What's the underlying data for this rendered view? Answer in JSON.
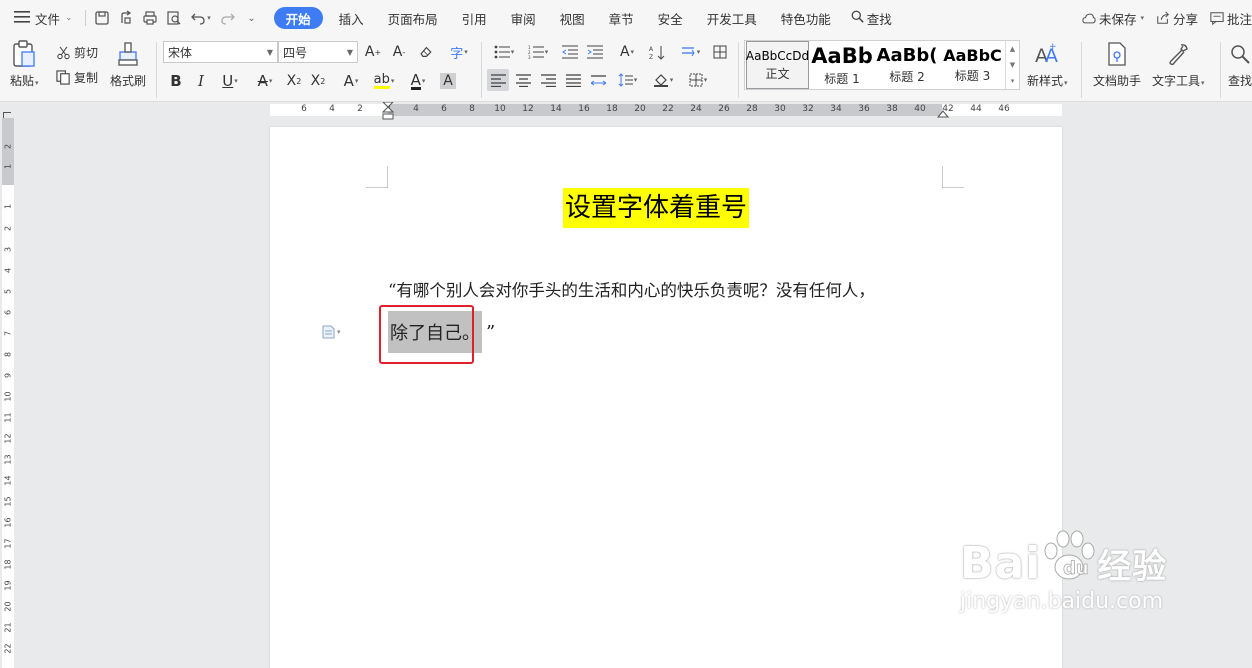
{
  "menubar": {
    "menu_label": "文件",
    "tabs": [
      {
        "label": "开始",
        "active": true
      },
      {
        "label": "插入",
        "active": false
      },
      {
        "label": "页面布局",
        "active": false
      },
      {
        "label": "引用",
        "active": false
      },
      {
        "label": "审阅",
        "active": false
      },
      {
        "label": "视图",
        "active": false
      },
      {
        "label": "章节",
        "active": false
      },
      {
        "label": "安全",
        "active": false
      },
      {
        "label": "开发工具",
        "active": false
      },
      {
        "label": "特色功能",
        "active": false
      }
    ],
    "search_label": "查找",
    "unsaved_label": "未保存",
    "share_label": "分享",
    "comment_label": "批注"
  },
  "ribbon": {
    "paste_label": "粘贴",
    "cut_label": "剪切",
    "copy_label": "复制",
    "format_painter_label": "格式刷",
    "font_name": "宋体",
    "font_size": "四号",
    "styles": [
      {
        "sample": "AaBbCcDd",
        "name": "正文",
        "active": true
      },
      {
        "sample": "AaBb",
        "name": "标题 1",
        "active": false
      },
      {
        "sample": "AaBb(",
        "name": "标题 2",
        "active": false
      },
      {
        "sample": "AaBbC",
        "name": "标题 3",
        "active": false
      }
    ],
    "new_style_label": "新样式",
    "doc_assistant_label": "文档助手",
    "text_tools_label": "文字工具",
    "find_label": "查找"
  },
  "ruler": {
    "h_numbers": [
      "6",
      "4",
      "2",
      "2",
      "4",
      "6",
      "8",
      "10",
      "12",
      "14",
      "16",
      "18",
      "20",
      "22",
      "24",
      "26",
      "28",
      "30",
      "32",
      "34",
      "36",
      "38",
      "40",
      "42",
      "44",
      "46"
    ],
    "v_numbers": [
      "2",
      "1",
      "1",
      "2",
      "3",
      "4",
      "5",
      "6",
      "7",
      "8",
      "9",
      "10",
      "11",
      "12",
      "13",
      "14",
      "15",
      "16",
      "17",
      "18",
      "19",
      "20",
      "21",
      "22"
    ]
  },
  "document": {
    "title": "设置字体着重号",
    "paragraph_line1": "“有哪个别人会对你手头的生活和内心的快乐负责呢？没有任何人，",
    "highlighted_text": "除了自己。",
    "paragraph_tail": "”"
  },
  "watermark": {
    "main": "Bai",
    "brand_cn": "经验",
    "sub": "jingyan.baidu.com"
  },
  "colors": {
    "accent": "#3d7cf5",
    "title_highlight": "#ffff00",
    "selection_grey": "#c1c1c1",
    "callout_red": "#e0202a"
  }
}
